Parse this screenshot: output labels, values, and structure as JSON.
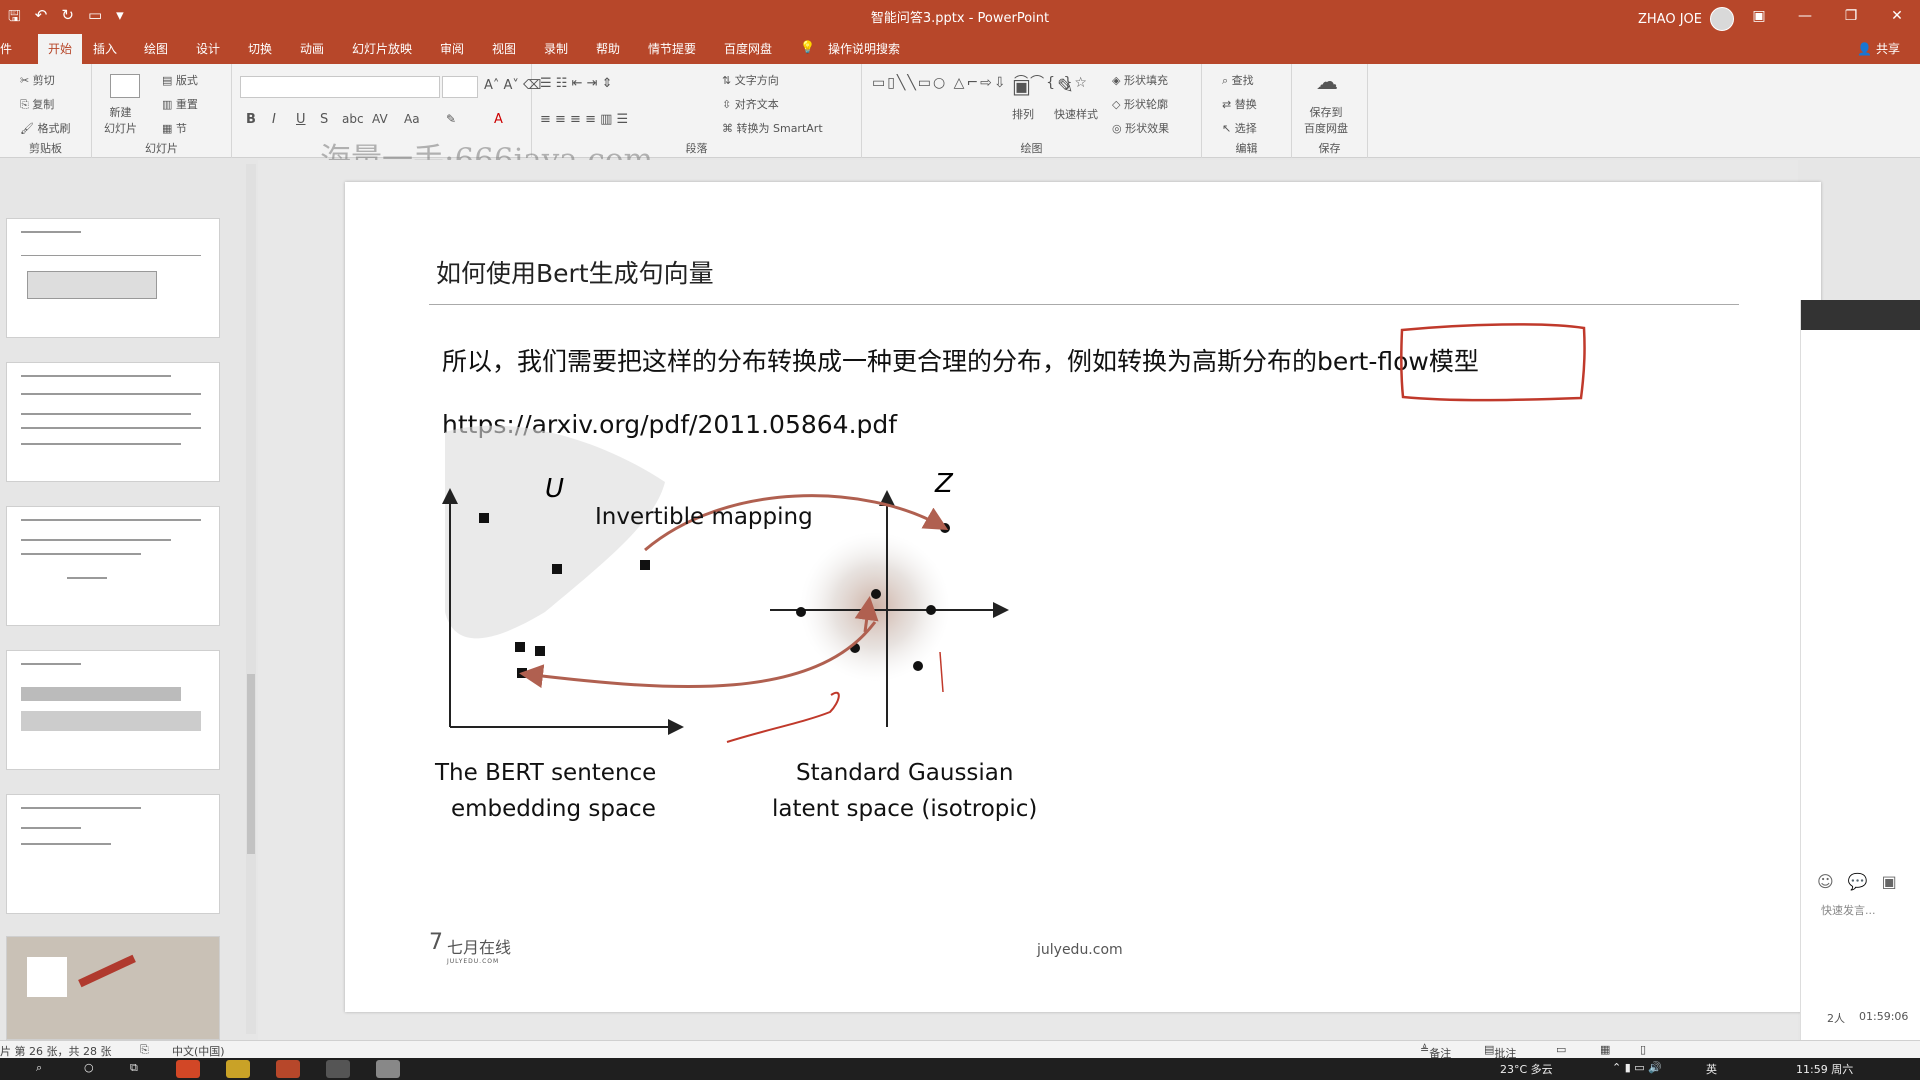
{
  "window": {
    "title": "智能问答3.pptx  -  PowerPoint",
    "user": "ZHAO JOE",
    "qat_icons": [
      "save-icon",
      "undo-icon",
      "redo-icon",
      "present-icon"
    ]
  },
  "tabs": [
    "开始",
    "插入",
    "绘图",
    "设计",
    "切换",
    "动画",
    "幻灯片放映",
    "审阅",
    "视图",
    "录制",
    "帮助",
    "情节提要",
    "百度网盘"
  ],
  "tab_left": "件",
  "tell_me": "操作说明搜索",
  "share": "共享",
  "ribbon": {
    "clipboard": {
      "cut": "剪切",
      "copy": "复制",
      "format_painter": "格式刷",
      "label": "剪贴板"
    },
    "slides": {
      "new_slide": "新建\n幻灯片",
      "layout": "版式",
      "reset": "重置",
      "section": "节",
      "label": "幻灯片"
    },
    "paragraph": {
      "text_direction": "文字方向",
      "align_text": "对齐文本",
      "smartart": "转换为 SmartArt",
      "label": "段落"
    },
    "drawing": {
      "arrange": "排列",
      "quick_styles": "快速样式",
      "fill": "形状填充",
      "outline": "形状轮廓",
      "effects": "形状效果",
      "label": "绘图"
    },
    "editing": {
      "find": "查找",
      "replace": "替换",
      "select": "选择",
      "label": "编辑"
    },
    "save": {
      "save_to_baidu": "保存到\n百度网盘",
      "label": "保存"
    }
  },
  "watermark": "海量一手:666java.com",
  "slide": {
    "title": "如何使用Bert生成句向量",
    "body": "所以，我们需要把这样的分布转换成一种更合理的分布，例如转换为高斯分布的bert-flow模型",
    "url": "https://arxiv.org/pdf/2011.05864.pdf",
    "footer": "julyedu.com",
    "logo": "七月在线",
    "logo_sub": "JULYEDU.COM",
    "figure": {
      "label_u": "U",
      "label_z": "Z",
      "mapping": "Invertible mapping",
      "left_caption_1": "The BERT sentence",
      "left_caption_2": "embedding space",
      "right_caption_1": "Standard Gaussian",
      "right_caption_2": "latent space (isotropic)"
    }
  },
  "right_pane": {
    "hint": "快速发言...",
    "count": "2人",
    "time": "01:59:06"
  },
  "status": {
    "slide_info": "片 第 26 张，共 28 张",
    "language": "中文(中国)",
    "notes": "备注",
    "comments": "批注"
  },
  "taskbar": {
    "weather": "23°C 多云",
    "lang": "英",
    "clock": "11:59 周六"
  }
}
